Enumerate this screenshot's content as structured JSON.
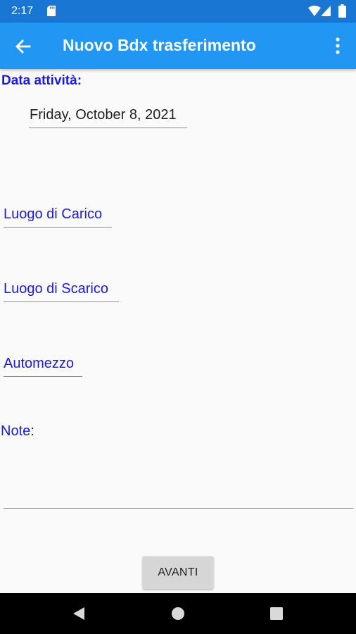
{
  "status_bar": {
    "time": "2:17",
    "icons": [
      "sd-card-icon",
      "wifi-icon",
      "signal-icon",
      "battery-icon"
    ],
    "background": "#1976d2"
  },
  "app_bar": {
    "title": "Nuovo Bdx trasferimento",
    "back_icon": "arrow-back-icon",
    "overflow_icon": "more-vert-icon",
    "background": "#2196f3"
  },
  "form": {
    "date_label": "Data attività:",
    "date_value": "Friday, October 8, 2021",
    "loading_place": "Luogo di Carico",
    "unloading_place": "Luogo di Scarico",
    "vehicle": "Automezzo",
    "note_label": "Note:",
    "note_value": "",
    "label_color": "#1a1ae6"
  },
  "actions": {
    "next_label": "AVANTI"
  },
  "nav_bar": {
    "icons": [
      "nav-back-icon",
      "nav-home-icon",
      "nav-recents-icon"
    ]
  }
}
